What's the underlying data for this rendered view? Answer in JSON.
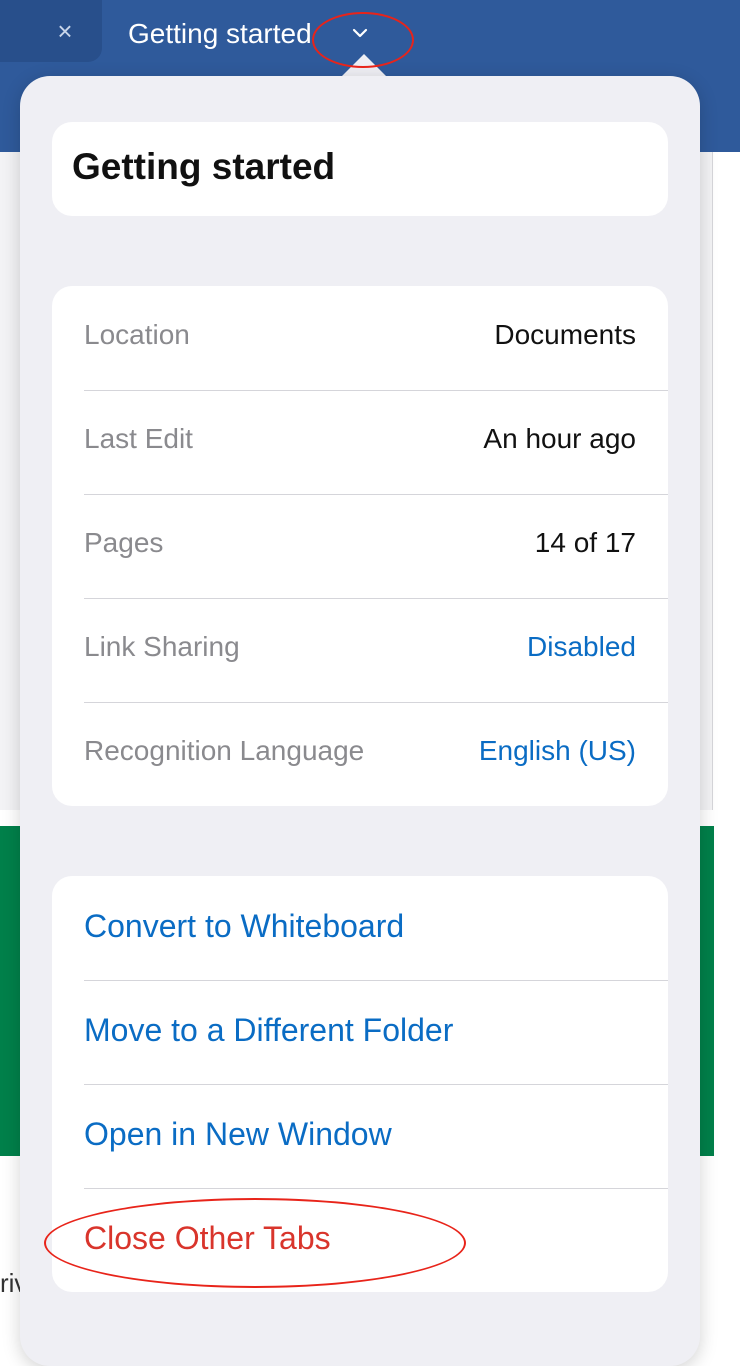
{
  "tab_bar": {
    "inactive_tab_close": "×",
    "active_tab_title": "Getting started",
    "accent_color": "#2f5a9b"
  },
  "background": {
    "text_fragment": "riv"
  },
  "popover": {
    "title": "Getting started",
    "info_rows": [
      {
        "label": "Location",
        "value": "Documents",
        "is_link": false
      },
      {
        "label": "Last Edit",
        "value": "An hour ago",
        "is_link": false
      },
      {
        "label": "Pages",
        "value": "14 of 17",
        "is_link": false
      },
      {
        "label": "Link Sharing",
        "value": "Disabled",
        "is_link": true
      },
      {
        "label": "Recognition Language",
        "value": "English (US)",
        "is_link": true
      }
    ],
    "actions": [
      {
        "label": "Convert to Whiteboard",
        "destructive": false
      },
      {
        "label": "Move to a Different Folder",
        "destructive": false
      },
      {
        "label": "Open in New Window",
        "destructive": false
      },
      {
        "label": "Close Other Tabs",
        "destructive": true
      }
    ],
    "link_color": "#0a6cc4",
    "destructive_color": "#d9352c"
  },
  "icons": {
    "tab_close": "close-icon",
    "tab_menu": "chevron-down-icon"
  }
}
